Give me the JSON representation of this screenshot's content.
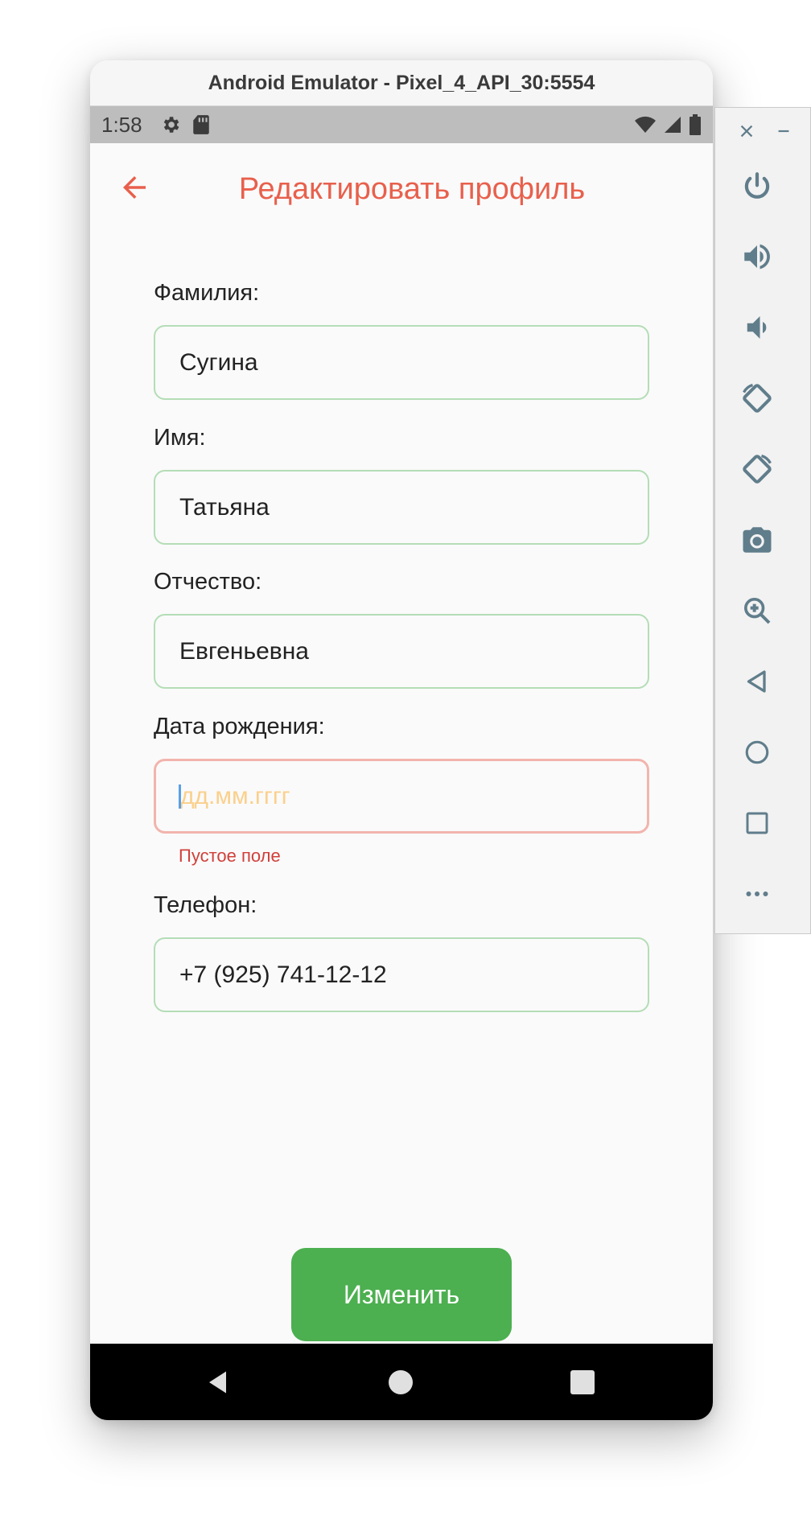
{
  "window": {
    "title": "Android Emulator - Pixel_4_API_30:5554"
  },
  "status_bar": {
    "time": "1:58"
  },
  "app_bar": {
    "title": "Редактировать профиль"
  },
  "form": {
    "last_name": {
      "label": "Фамилия:",
      "value": "Сугина"
    },
    "first_name": {
      "label": "Имя:",
      "value": "Татьяна"
    },
    "patronymic": {
      "label": "Отчество:",
      "value": "Евгеньевна"
    },
    "birth_date": {
      "label": "Дата рождения:",
      "value": "",
      "placeholder": "дд.мм.гггг",
      "error": "Пустое поле"
    },
    "phone": {
      "label": "Телефон:",
      "value": "+7 (925) 741-12-12"
    }
  },
  "submit": {
    "label": "Изменить"
  },
  "side_panel": {
    "controls": [
      "close-icon",
      "minimize-icon",
      "power-icon",
      "volume-up-icon",
      "volume-down-icon",
      "rotate-left-icon",
      "rotate-right-icon",
      "camera-icon",
      "zoom-icon",
      "back-icon",
      "home-icon",
      "overview-icon",
      "more-icon"
    ]
  },
  "colors": {
    "accent": "#e8604c",
    "button": "#4caf50",
    "field_border": "#b4ddb6",
    "error_border": "#f2b4ad",
    "error_text": "#d0403a"
  }
}
